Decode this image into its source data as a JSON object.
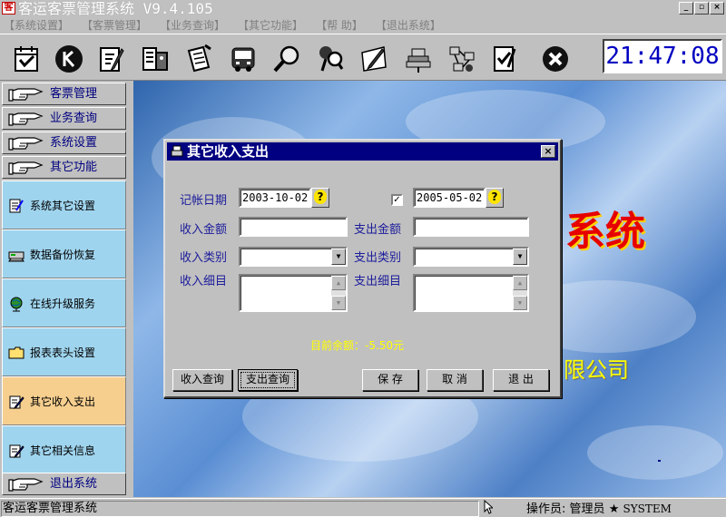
{
  "window": {
    "title": "客运客票管理系统 V9.4.105",
    "controls": [
      "_",
      "▫",
      "×"
    ]
  },
  "menu": [
    "【系统设置】",
    "【客票管理】",
    "【业务查询】",
    "【其它功能】",
    "【帮  助】",
    "【退出系统】"
  ],
  "toolbar": {
    "icons": [
      "calendar-check-icon",
      "k-circle-icon",
      "edit-pencil-icon",
      "ticket-printer-icon",
      "notepad-write-icon",
      "bus-icon",
      "magnifier-icon",
      "search-person-icon",
      "pen-paper-icon",
      "server-icon",
      "network-icon",
      "checklist-icon",
      "close-circle-icon"
    ],
    "clock": "21:47:08"
  },
  "sidebar": {
    "nav": [
      "客票管理",
      "业务查询",
      "系统设置",
      "其它功能"
    ],
    "sub_items": [
      "系统其它设置",
      "数据备份恢复",
      "在线升级服务",
      "报表表头设置",
      "其它收入支出",
      "其它相关信息"
    ],
    "active_sub": "其它收入支出",
    "exit_label": "退出系统"
  },
  "background": {
    "text_system": "系统",
    "text_company": "限公司"
  },
  "dialog": {
    "title": "其它收入支出",
    "close": "×",
    "date_label": "记帐日期",
    "date_from": "2003-10-02",
    "date_to": "2005-05-02",
    "date_to_checked": "✓",
    "query_symbol": "?",
    "income_amount_label": "收入金额",
    "expense_amount_label": "支出金额",
    "income_type_label": "收入类别",
    "expense_type_label": "支出类别",
    "income_detail_label": "收入细目",
    "expense_detail_label": "支出细目",
    "balance_text": "目前余额：-5.50元",
    "buttons": {
      "income_query": "收入查询",
      "expense_query": "支出查询",
      "save": "保  存",
      "cancel": "取  消",
      "exit": "退  出"
    }
  },
  "status": {
    "left": "客运客票管理系统",
    "operator_label": "操作员:",
    "operator_name": "管理员",
    "star": "★",
    "system_user": "SYSTEM"
  }
}
